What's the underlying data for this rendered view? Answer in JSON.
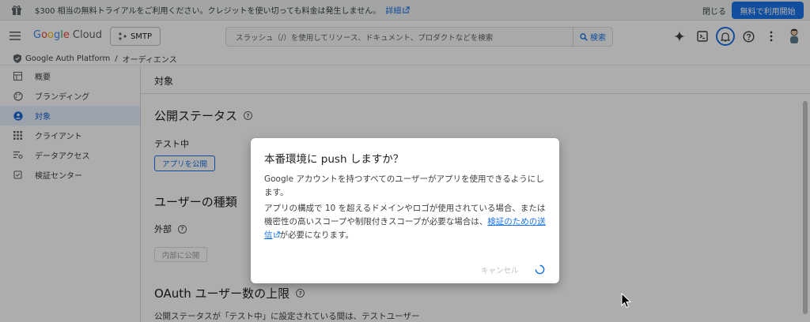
{
  "banner": {
    "text": "$300 相当の無料トライアルをご利用ください。クレジットを使い切っても料金は発生しません。",
    "detail_link": "詳細",
    "close": "閉じる",
    "start_button": "無料で利用開始"
  },
  "header": {
    "logo_google": [
      "G",
      "o",
      "o",
      "g",
      "l",
      "e"
    ],
    "logo_cloud": "Cloud",
    "project": "SMTP",
    "search_placeholder": "スラッシュ（/）を使用してリソース、ドキュメント、プロダクトなどを検索",
    "search_button": "検索",
    "icons": [
      "gemini-icon",
      "terminal-icon",
      "bell-icon",
      "help-icon",
      "more-icon",
      "avatar"
    ]
  },
  "breadcrumb": {
    "root": "Google Auth Platform",
    "separator": "/",
    "current": "オーディエンス"
  },
  "sidebar": {
    "items": [
      {
        "label": "概要",
        "icon": "dashboard-icon"
      },
      {
        "label": "ブランディング",
        "icon": "palette-icon"
      },
      {
        "label": "対象",
        "icon": "person-icon",
        "active": true
      },
      {
        "label": "クライアント",
        "icon": "apps-icon"
      },
      {
        "label": "データアクセス",
        "icon": "data-access-icon"
      },
      {
        "label": "検証センター",
        "icon": "verified-icon"
      }
    ]
  },
  "main": {
    "title": "対象",
    "publish_status": {
      "heading": "公開ステータス",
      "state": "テスト中",
      "button": "アプリを公開"
    },
    "user_type": {
      "heading": "ユーザーの種類",
      "value": "外部",
      "button": "内部に公開"
    },
    "oauth_limit": {
      "heading": "OAuth ユーザー数の上限",
      "text": "公開ステータスが「テスト中」に設定されている間は、テストユーザー"
    }
  },
  "dialog": {
    "title": "本番環境に push しますか？",
    "paragraph1": "Google アカウントを持つすべてのユーザーがアプリを使用できるようにします。",
    "paragraph2_before": "アプリの構成で 10 を超えるドメインやロゴが使用されている場合、または機密性の高いスコープや制限付きスコープが必要な場合は、",
    "paragraph2_link": "検証のための送信",
    "paragraph2_after": "が必要になります。",
    "cancel": "キャンセル"
  },
  "colors": {
    "accent": "#1a73e8",
    "active_bg": "#e8f0fe",
    "overlay": "rgba(0,0,0,0.32)"
  }
}
